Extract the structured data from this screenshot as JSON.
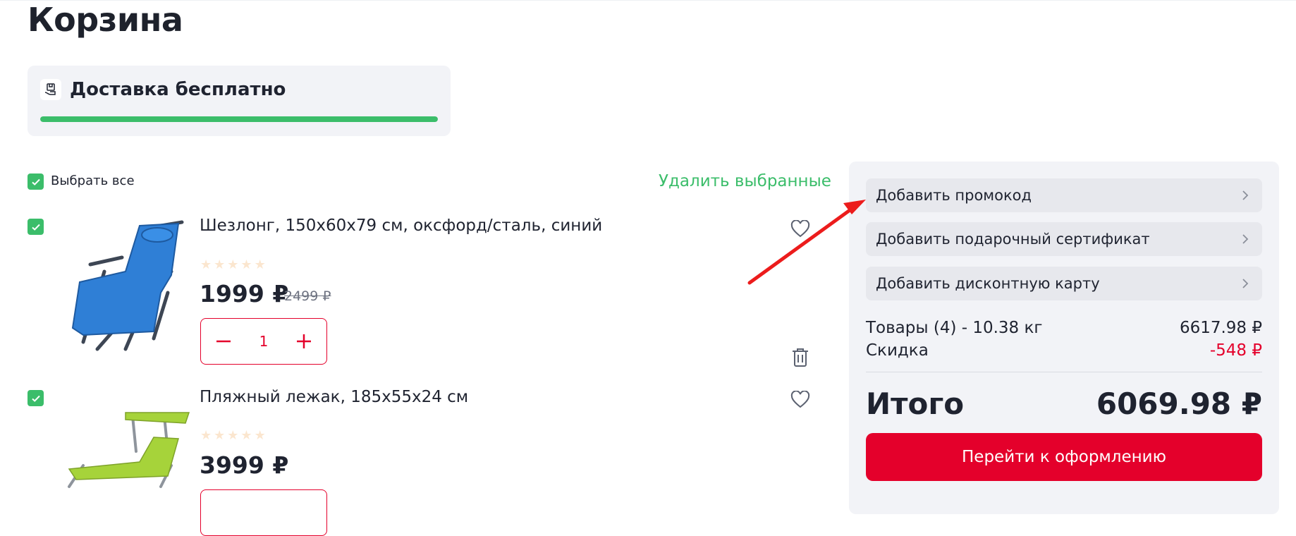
{
  "page": {
    "title": "Корзина"
  },
  "delivery": {
    "text": "Доставка бесплатно",
    "progress_percent": 100,
    "icon": "delivery-box-icon"
  },
  "list_header": {
    "select_all_label": "Выбрать все",
    "delete_selected_label": "Удалить выбранные"
  },
  "items": [
    {
      "title": "Шезлонг, 150х60х79 см, оксфорд/сталь, синий",
      "rating": 0,
      "price": "1999 ₽",
      "old_price": "2499 ₽",
      "quantity": "1",
      "image_color": "#2f7fd6"
    },
    {
      "title": "Пляжный лежак, 185х55х24 см",
      "rating": 0,
      "price": "3999 ₽",
      "image_color": "#a6d33a"
    }
  ],
  "summary": {
    "promo_label": "Добавить промокод",
    "gift_label": "Добавить подарочный сертификат",
    "discount_card_label": "Добавить дисконтную карту",
    "goods_label": "Товары (4) - 10.38 кг",
    "goods_value": "6617.98 ₽",
    "discount_label": "Скидка",
    "discount_value": "-548 ₽",
    "total_label": "Итого",
    "total_value": "6069.98 ₽",
    "checkout_label": "Перейти к оформлению"
  },
  "colors": {
    "accent_green": "#3bbd6a",
    "accent_red": "#e4002b",
    "panel_bg": "#f2f3f7"
  }
}
